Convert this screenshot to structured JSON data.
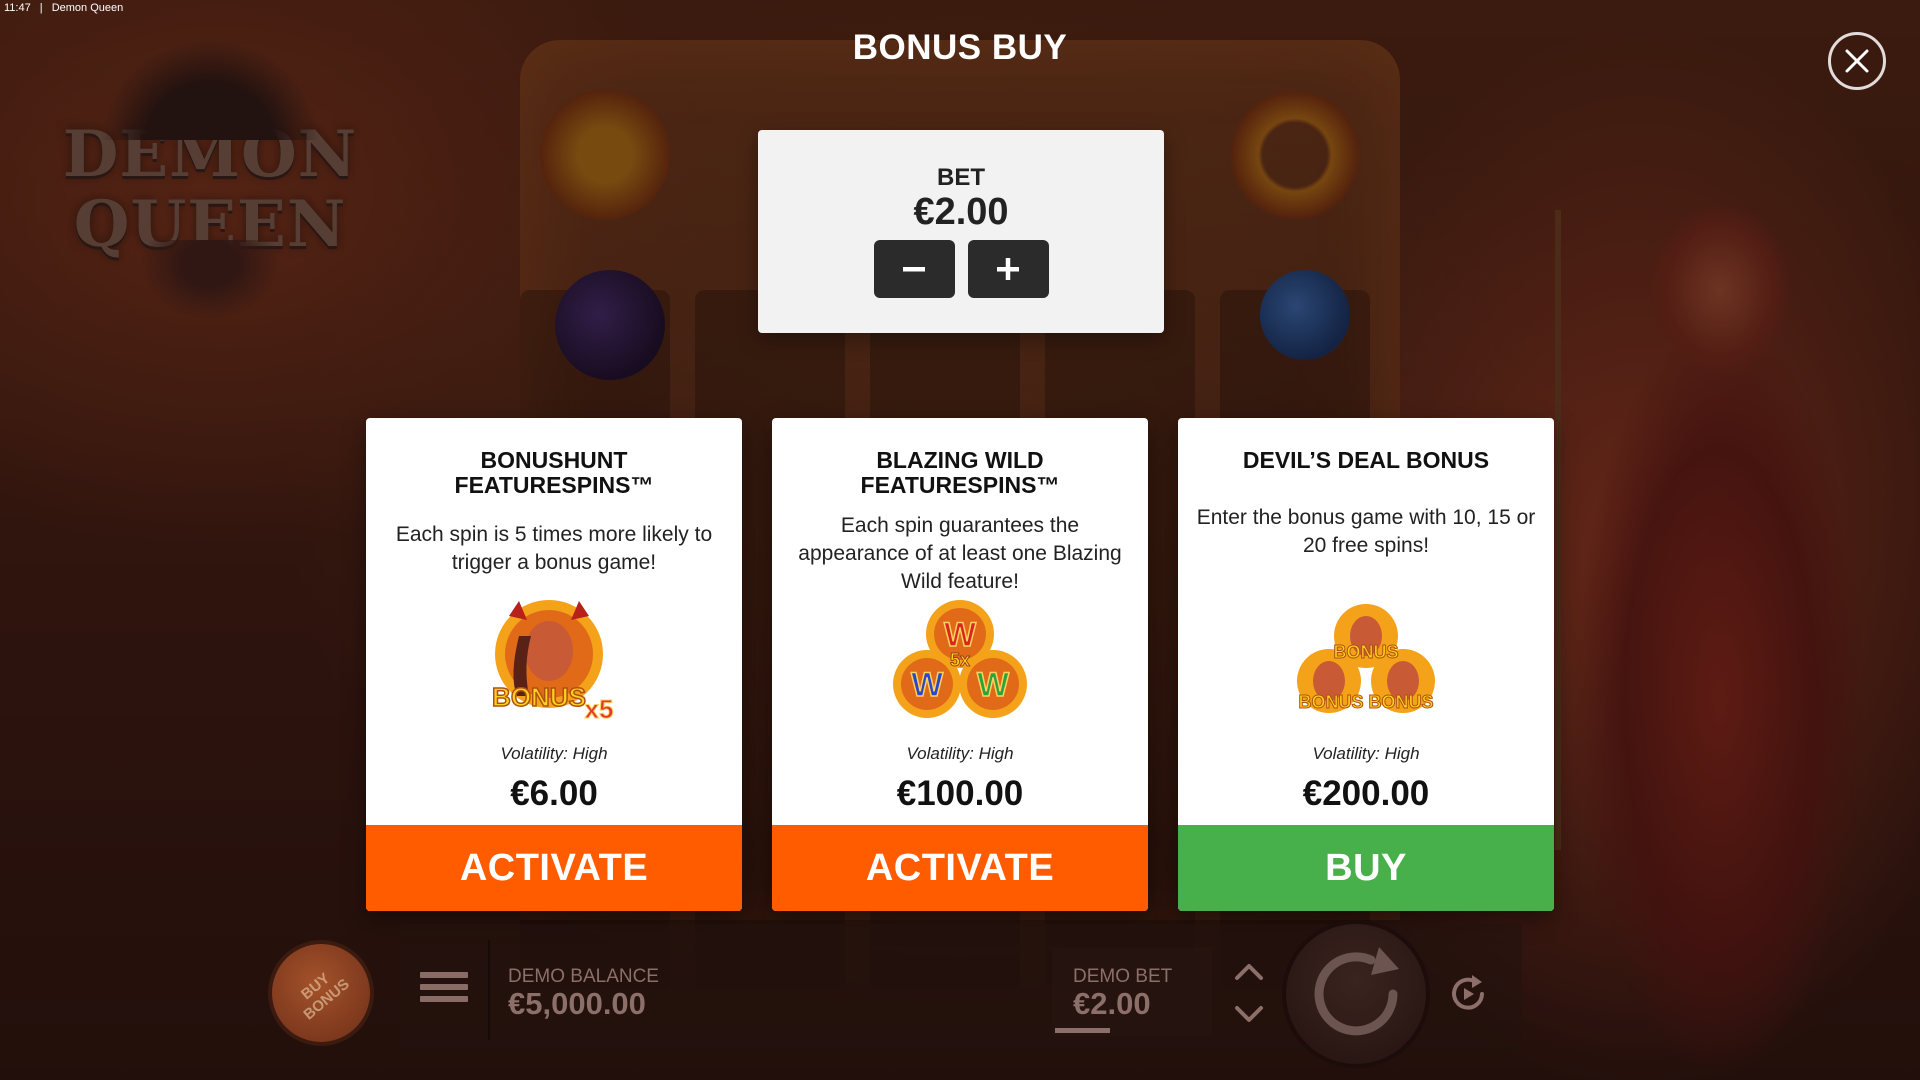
{
  "status": {
    "time": "11:47",
    "app_title": "Demon Queen"
  },
  "logo": {
    "line1": "DEMON",
    "line2": "QUEEN"
  },
  "modal": {
    "title": "BONUS BUY",
    "bet": {
      "label": "BET",
      "value": "€2.00",
      "decrease_icon": "minus-icon",
      "increase_icon": "plus-icon"
    },
    "close_icon": "close-icon"
  },
  "cards": [
    {
      "title_line1": "BONUSHUNT",
      "title_line2": "FEATURESPINS™",
      "description": "Each spin is 5 times more likely to trigger a bonus game!",
      "art_text": "BONUS",
      "art_multiplier": "x5",
      "volatility": "Volatility: High",
      "price": "€6.00",
      "action": "ACTIVATE",
      "action_color": "#ff5c00"
    },
    {
      "title_line1": "BLAZING WILD",
      "title_line2": "FEATURESPINS™",
      "description": "Each spin guarantees the appearance of at least one Blazing Wild feature!",
      "art_text": "W",
      "art_multiplier": "5x",
      "volatility": "Volatility: High",
      "price": "€100.00",
      "action": "ACTIVATE",
      "action_color": "#ff5c00"
    },
    {
      "title_line1": "DEVIL’S DEAL BONUS",
      "title_line2": "",
      "description": "Enter the bonus game with 10, 15 or 20 free spins!",
      "art_text": "BONUS",
      "art_multiplier": "",
      "volatility": "Volatility: High",
      "price": "€200.00",
      "action": "BUY",
      "action_color": "#48b04a"
    }
  ],
  "bottom_bar": {
    "buy_bonus_line1": "BUY",
    "buy_bonus_line2": "BONUS",
    "balance_label": "DEMO BALANCE",
    "balance_value": "€5,000.00",
    "bet_label": "DEMO BET",
    "bet_value": "€2.00",
    "icons": [
      "menu-icon",
      "arrow-up-icon",
      "arrow-down-icon",
      "spin-icon",
      "autoplay-icon"
    ]
  }
}
